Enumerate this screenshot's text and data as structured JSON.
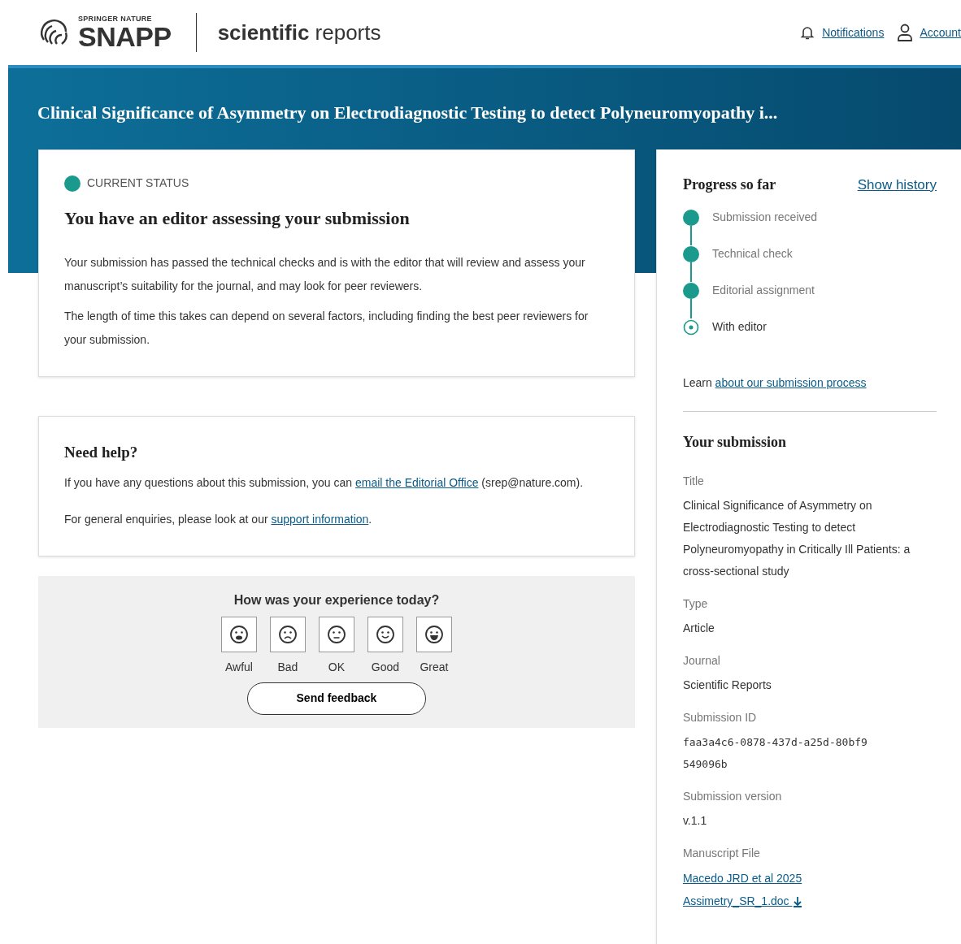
{
  "header": {
    "brand_top": "SPRINGER NATURE",
    "brand": "SNAPP",
    "journal_bold": "scientific",
    "journal_rest": "reports",
    "links": [
      {
        "kind": "bell",
        "label": "Notifications"
      },
      {
        "kind": "person",
        "label": "Account"
      }
    ]
  },
  "page_title": "Clinical Significance of Asymmetry on Electrodiagnostic Testing to detect Polyneuromyopathy i...",
  "status_card": {
    "label": "CURRENT STATUS",
    "heading": "You have an editor assessing your submission",
    "paragraphs": [
      "Your submission has passed the technical checks and is with the editor that will review and assess your manuscript’s suitability for the journal, and may look for peer reviewers.",
      "The length of time this takes can depend on several factors, including finding the best peer reviewers for your submission."
    ]
  },
  "help_card": {
    "heading": "Need help?",
    "paragraphs": [
      {
        "before": "If you have any questions about this submission, you can ",
        "link": "email the Editorial Office",
        "after": " (srep@nature.com)."
      },
      {
        "before": "For general enquiries, please look at our ",
        "link": "support information",
        "after": "."
      }
    ]
  },
  "feedback": {
    "question": "How was your experience today?",
    "options": [
      {
        "kind": "awful",
        "label": "Awful"
      },
      {
        "kind": "bad",
        "label": "Bad"
      },
      {
        "kind": "ok",
        "label": "OK"
      },
      {
        "kind": "good",
        "label": "Good"
      },
      {
        "kind": "great",
        "label": "Great"
      }
    ],
    "button": "Send feedback"
  },
  "progress": {
    "heading": "Progress so far",
    "history_link": "Show history",
    "steps": [
      {
        "label": "Submission received",
        "kind": "done"
      },
      {
        "label": "Technical check",
        "kind": "done"
      },
      {
        "label": "Editorial assignment",
        "kind": "done"
      },
      {
        "label": "With editor",
        "kind": "current"
      }
    ],
    "learn_before": "Learn ",
    "learn_link": "about our submission process"
  },
  "submission": {
    "heading": "Your submission",
    "fields": [
      {
        "label": "Title",
        "value": "Clinical Significance of Asymmetry on Electrodiagnostic Testing to detect Polyneuromyopathy in Critically Ill Patients: a cross-sectional study",
        "kind": "text"
      },
      {
        "label": "Type",
        "value": "Article",
        "kind": "text"
      },
      {
        "label": "Journal",
        "value": "Scientific Reports",
        "kind": "text"
      },
      {
        "label": "Submission ID",
        "value": "faa3a4c6-0878-437d-a25d-80bf9549096b",
        "kind": "code"
      },
      {
        "label": "Submission version",
        "value": "v.1.1",
        "kind": "text"
      },
      {
        "label": "Manuscript File",
        "value": "Macedo JRD et al 2025 Assimetry_SR_1.doc",
        "kind": "file"
      }
    ]
  }
}
